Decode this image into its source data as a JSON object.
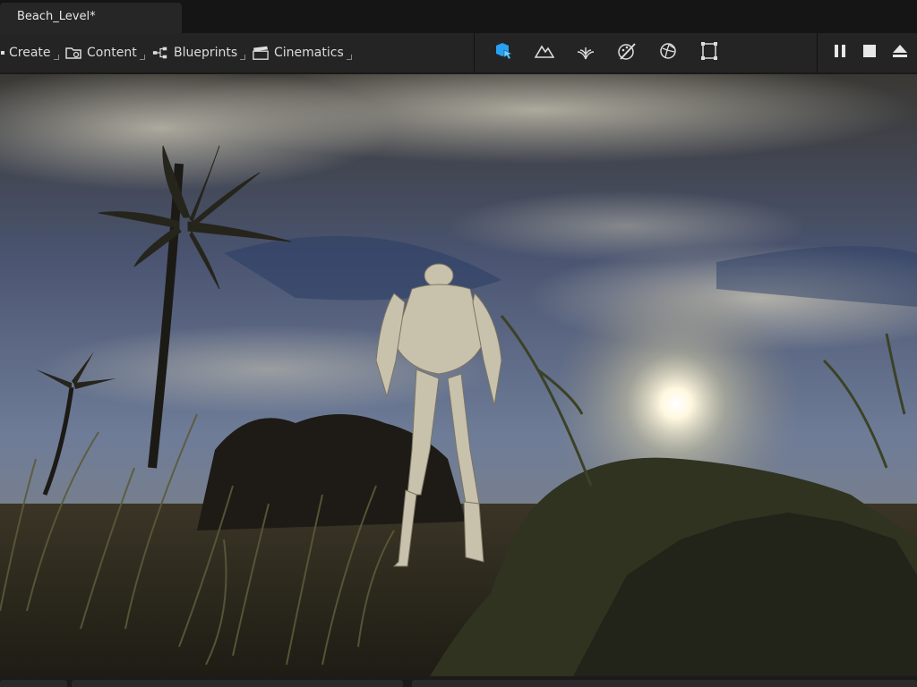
{
  "window": {
    "tab_title": "Beach_Level*"
  },
  "toolbar": {
    "items": [
      {
        "label": "Create",
        "icon": "create-icon"
      },
      {
        "label": "Content",
        "icon": "content-folder-icon"
      },
      {
        "label": "Blueprints",
        "icon": "blueprints-icon"
      },
      {
        "label": "Cinematics",
        "icon": "cinematics-clapper-icon"
      }
    ],
    "modes": [
      {
        "icon": "select-mode-icon",
        "active": true
      },
      {
        "icon": "landscape-mode-icon"
      },
      {
        "icon": "foliage-mode-icon"
      },
      {
        "icon": "mesh-paint-mode-icon"
      },
      {
        "icon": "fracture-mode-icon"
      },
      {
        "icon": "modeling-mode-icon"
      }
    ],
    "playback": [
      {
        "icon": "pause-icon"
      },
      {
        "icon": "stop-icon"
      },
      {
        "icon": "eject-icon"
      }
    ],
    "accent_color": "#2aa0f0"
  },
  "viewport": {
    "description_colors": {
      "sky_top": "#2b2a25",
      "sky_blue": "#3b5078",
      "sun": "#ffffff",
      "ground": "#2e2a1f"
    }
  }
}
